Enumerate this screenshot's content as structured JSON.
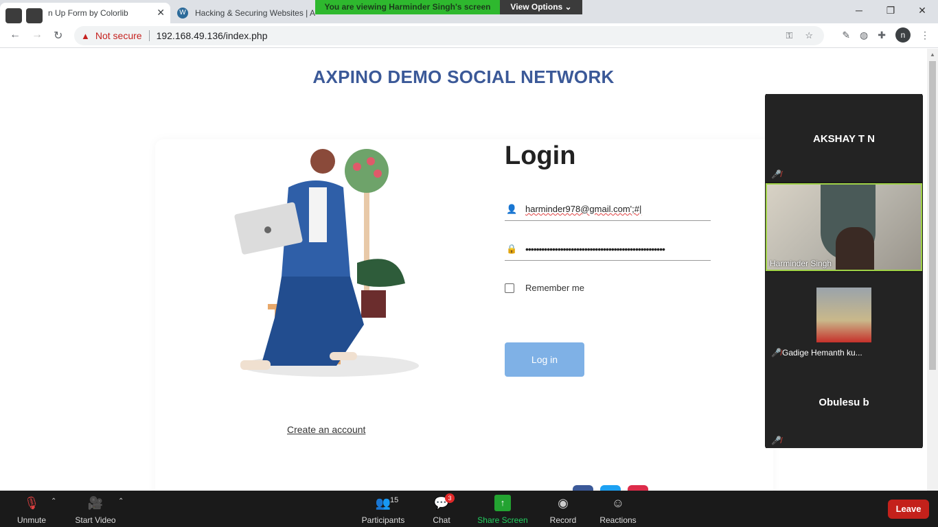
{
  "browser": {
    "tabs": [
      {
        "title": "n Up Form by Colorlib"
      },
      {
        "title": "Hacking & Securing Websites | A"
      }
    ],
    "security_label": "Not secure",
    "url": "192.168.49.136/index.php",
    "profile_initial": "n"
  },
  "share_banner": {
    "message": "You are viewing Harminder Singh's screen",
    "options": "View Options ⌄"
  },
  "page": {
    "site_title": "AXPINO DEMO SOCIAL NETWORK",
    "login_heading": "Login",
    "email_value": "harminder978@gmail.com';#|",
    "password_value": "••••••••••••••••••••••••••••••••••••••••••••••••••••",
    "remember_label": "Remember me",
    "login_button": "Log in",
    "create_account": "Create an account"
  },
  "participants_panel": {
    "tiles": [
      {
        "name": "AKSHAY T N"
      },
      {
        "name": "Harminder Singh"
      },
      {
        "name": "Gadige Hemanth ku..."
      },
      {
        "name": "Obulesu b"
      }
    ]
  },
  "zoom_toolbar": {
    "unmute": "Unmute",
    "start_video": "Start Video",
    "participants": "Participants",
    "participants_count": "15",
    "chat": "Chat",
    "chat_badge": "3",
    "share_screen": "Share Screen",
    "record": "Record",
    "reactions": "Reactions",
    "leave": "Leave"
  },
  "colors": {
    "site_title": "#3b5998",
    "login_button": "#7fb1e6",
    "share_banner": "#2eb82e",
    "leave": "#c4211b"
  }
}
